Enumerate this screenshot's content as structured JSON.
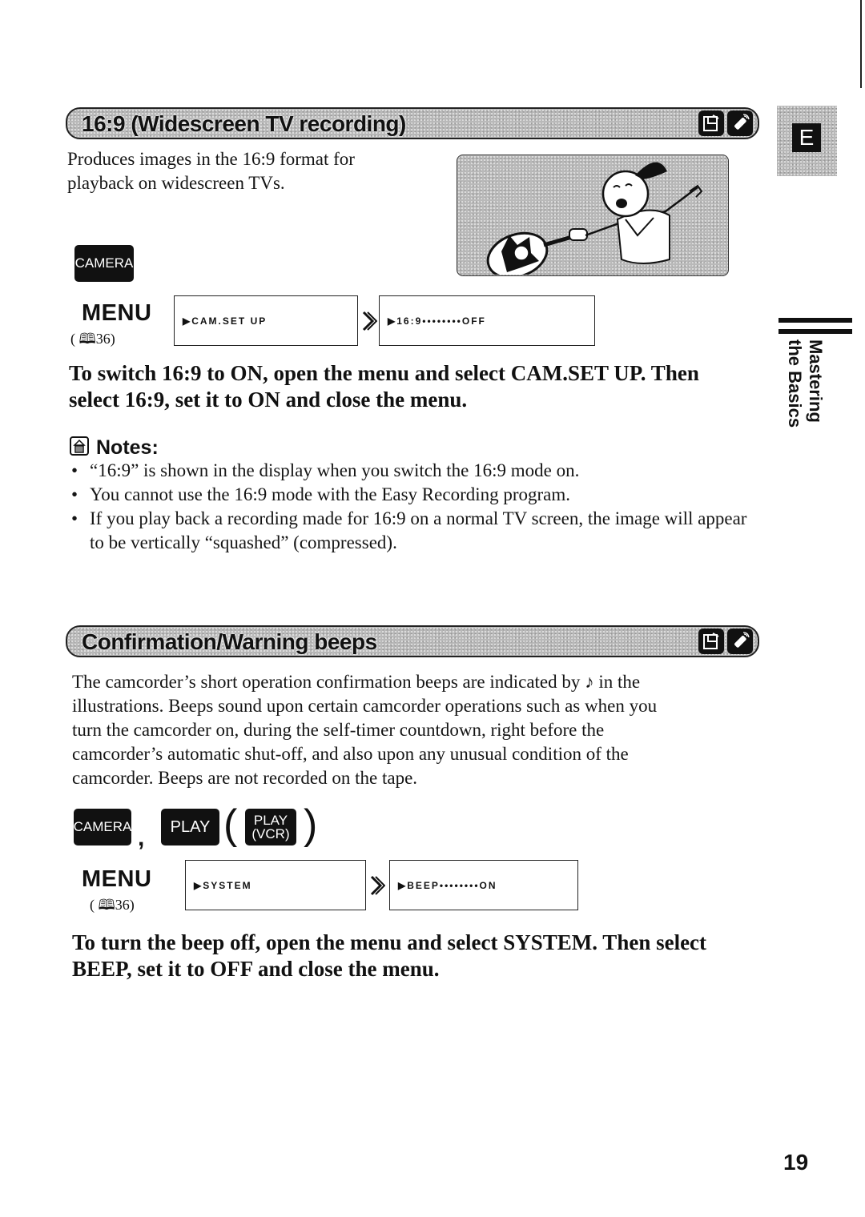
{
  "page_number": "19",
  "side_tab": {
    "language_letter": "E",
    "chapter_line1": "Mastering",
    "chapter_line2": "the Basics"
  },
  "sections": [
    {
      "title": "16:9 (Widescreen TV recording)",
      "icons": [
        "camcorder-icon",
        "remote-control-icon"
      ],
      "description": "Produces images in the 16:9 format for playback on widescreen TVs.",
      "description_lines": [
        "Produces images in the 16:9 format for",
        "playback on widescreen TVs."
      ],
      "illustration": "girl-playing-tennis-illustration",
      "modes": [
        "CAMERA"
      ],
      "menu": {
        "label": "MENU",
        "ref": "( 🕮 36)",
        "ref_page": "36",
        "step1": "▶CAM.SET UP",
        "step2": "▶16:9••••••••OFF"
      },
      "instruction_lines": [
        "To switch 16:9 to ON, open the menu and select CAM.SET UP. Then",
        "select 16:9, set it to ON and close the menu."
      ],
      "notes": {
        "heading": "Notes:",
        "items": [
          "“16:9” is shown in the display when you switch the 16:9 mode on.",
          "You cannot use the 16:9 mode with the Easy Recording program.",
          "If you play back a recording made for 16:9 on a normal TV screen, the image will appear to be vertically “squashed” (compressed)."
        ]
      }
    },
    {
      "title": "Confirmation/Warning beeps",
      "icons": [
        "camcorder-icon",
        "remote-control-icon"
      ],
      "description_lines": [
        "The camcorder’s short operation confirmation beeps are indicated by ♪ in the",
        "illustrations. Beeps sound upon certain camcorder operations such as when you",
        "turn the camcorder on, during the self-timer countdown, right before the",
        "camcorder’s automatic shut-off, and also upon any unusual condition of the",
        "camcorder. Beeps are not recorded on the tape."
      ],
      "modes": [
        "CAMERA",
        "PLAY",
        "PLAY (VCR)"
      ],
      "mode_labels": {
        "camera": "CAMERA",
        "play": "PLAY",
        "play_vcr_line1": "PLAY",
        "play_vcr_line2": "(VCR)",
        "separator": ",",
        "paren_open": "(",
        "paren_close": ")"
      },
      "menu": {
        "label": "MENU",
        "ref_page": "36",
        "step1": "▶SYSTEM",
        "step2": "▶BEEP••••••••ON"
      },
      "instruction_lines": [
        "To turn the beep off, open the menu and select SYSTEM. Then select",
        "BEEP, set it to OFF and close the menu."
      ]
    }
  ]
}
